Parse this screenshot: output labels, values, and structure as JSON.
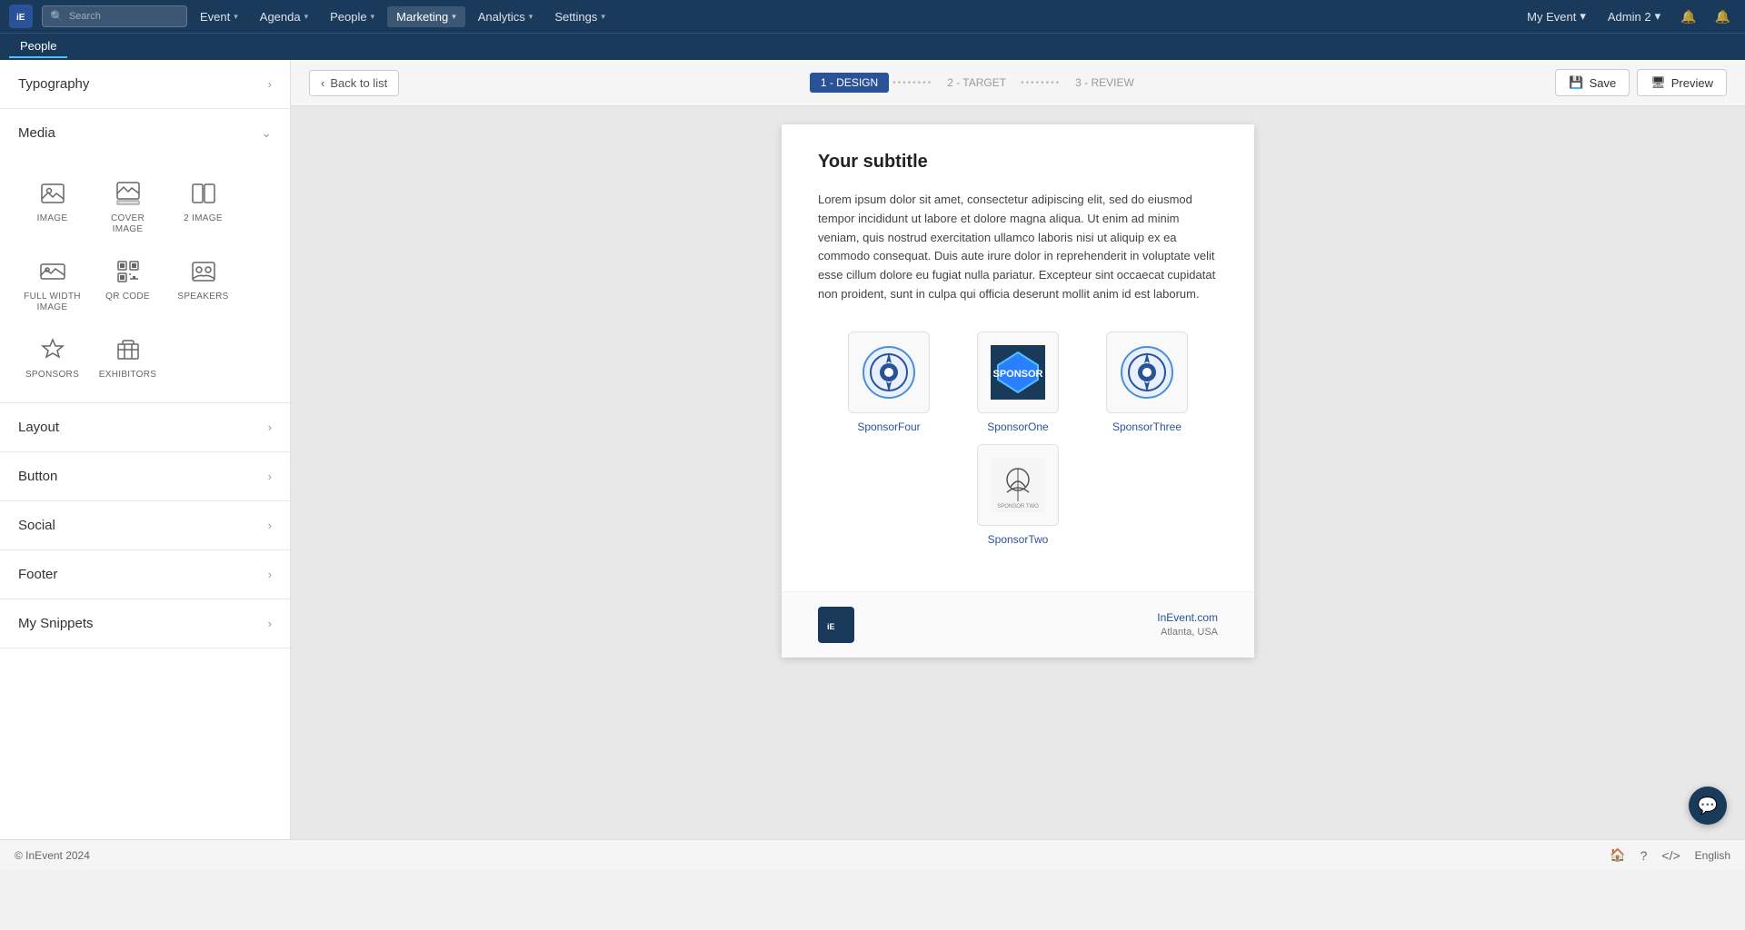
{
  "app": {
    "logo_text": "iE",
    "copyright": "© InEvent 2024"
  },
  "top_nav": {
    "search_placeholder": "Search",
    "items": [
      {
        "label": "Event",
        "has_chevron": true
      },
      {
        "label": "Agenda",
        "has_chevron": true
      },
      {
        "label": "People",
        "has_chevron": true
      },
      {
        "label": "Marketing",
        "has_chevron": true,
        "active": true
      },
      {
        "label": "Analytics",
        "has_chevron": true
      },
      {
        "label": "Settings",
        "has_chevron": true
      }
    ],
    "right": {
      "my_event": "My Event",
      "admin": "Admin 2"
    }
  },
  "second_nav": {
    "items": [
      {
        "label": "People",
        "active": true
      }
    ]
  },
  "editor_topbar": {
    "back_btn": "Back to list",
    "steps": [
      {
        "label": "1 - DESIGN",
        "active": true
      },
      {
        "label": "2 - TARGET",
        "active": false
      },
      {
        "label": "3 - REVIEW",
        "active": false
      }
    ],
    "save_btn": "Save",
    "preview_btn": "Preview"
  },
  "sidebar": {
    "sections": [
      {
        "id": "typography",
        "label": "Typography",
        "expanded": false
      },
      {
        "id": "media",
        "label": "Media",
        "expanded": true
      },
      {
        "id": "layout",
        "label": "Layout",
        "expanded": false
      },
      {
        "id": "button",
        "label": "Button",
        "expanded": false
      },
      {
        "id": "social",
        "label": "Social",
        "expanded": false
      },
      {
        "id": "footer",
        "label": "Footer",
        "expanded": false
      },
      {
        "id": "my-snippets",
        "label": "My Snippets",
        "expanded": false
      }
    ],
    "media_items": [
      {
        "id": "image",
        "label": "IMAGE",
        "icon": "image"
      },
      {
        "id": "cover-image",
        "label": "COVER IMAGE",
        "icon": "cover-image"
      },
      {
        "id": "2-image",
        "label": "2 IMAGE",
        "icon": "2-image"
      },
      {
        "id": "full-width-image",
        "label": "FULL WIDTH IMAGE",
        "icon": "full-width-image"
      },
      {
        "id": "qr-code",
        "label": "QR CODE",
        "icon": "qr-code"
      },
      {
        "id": "speakers",
        "label": "SPEAKERS",
        "icon": "speakers"
      },
      {
        "id": "sponsors",
        "label": "SPONSORS",
        "icon": "sponsors"
      },
      {
        "id": "exhibitors",
        "label": "EXHIBITORS",
        "icon": "exhibitors"
      }
    ]
  },
  "email_preview": {
    "subtitle": "Your subtitle",
    "body_text": "Lorem ipsum dolor sit amet, consectetur adipiscing elit, sed do eiusmod tempor incididunt ut labore et dolore magna aliqua. Ut enim ad minim veniam, quis nostrud exercitation ullamco laboris nisi ut aliquip ex ea commodo consequat. Duis aute irure dolor in reprehenderit in voluptate velit esse cillum dolore eu fugiat nulla pariatur. Excepteur sint occaecat cupidatat non proident, sunt in culpa qui officia deserunt mollit anim id est laborum.",
    "sponsors": [
      {
        "name": "SponsorFour",
        "id": "sponsor-four"
      },
      {
        "name": "SponsorOne",
        "id": "sponsor-one"
      },
      {
        "name": "SponsorThree",
        "id": "sponsor-three"
      },
      {
        "name": "SponsorTwo",
        "id": "sponsor-two"
      }
    ],
    "footer": {
      "website": "InEvent.com",
      "address": "Atlanta, USA"
    }
  },
  "status_bar": {
    "language": "English",
    "icons": [
      "home",
      "help",
      "code"
    ]
  }
}
